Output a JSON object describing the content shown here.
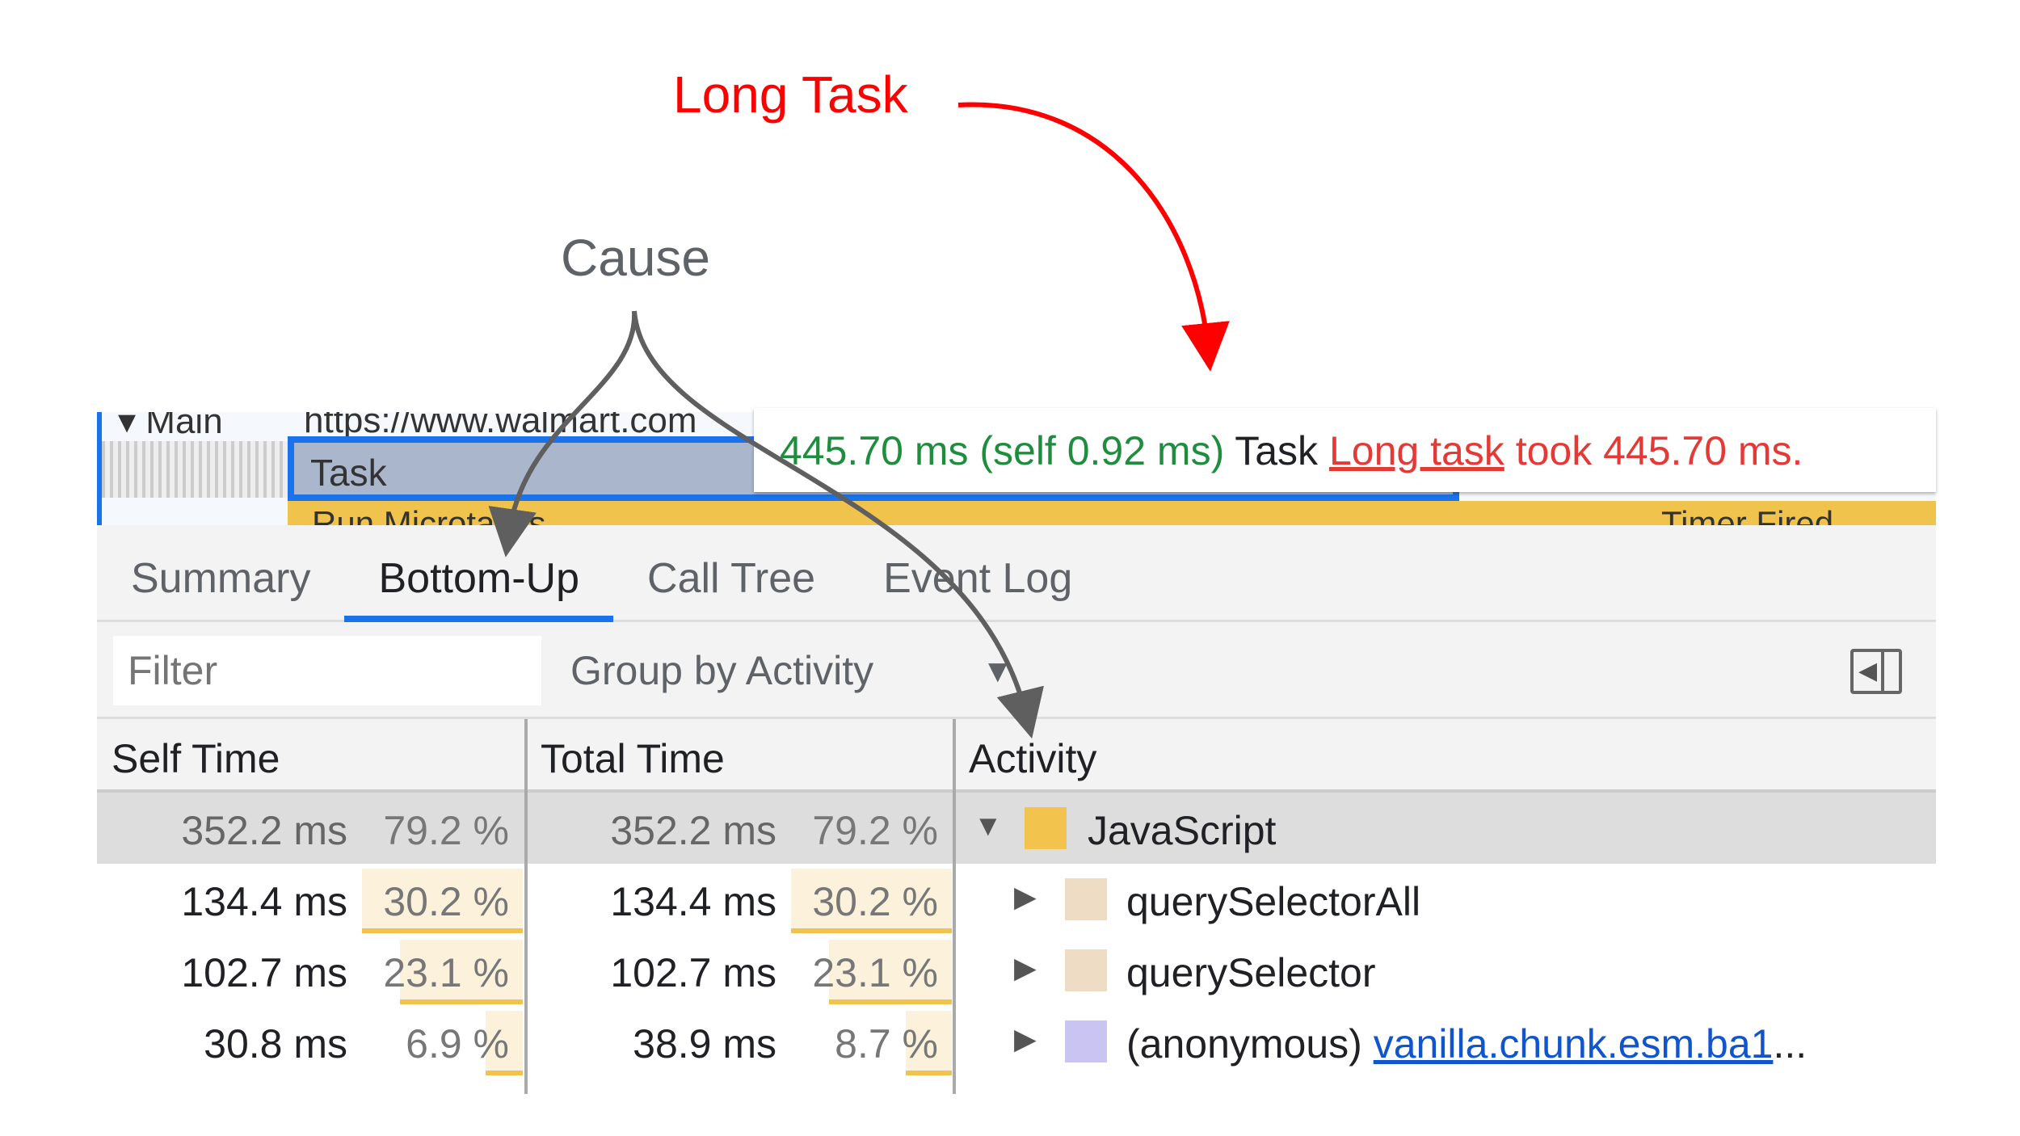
{
  "annotations": {
    "long_task": "Long Task",
    "cause": "Cause",
    "long_task_color": "#ff0000",
    "cause_color": "#5f6368"
  },
  "timeline": {
    "main_label": "▾ Main",
    "url": "https://www.walmart.com",
    "task_label": "Task",
    "microtasks": "Run Microtasks",
    "timer": "Timer Fired"
  },
  "tooltip": {
    "duration": "445.70 ms (self 0.92 ms)",
    "name": "Task",
    "link": "Long task",
    "message": "took 445.70 ms."
  },
  "tabs": [
    "Summary",
    "Bottom-Up",
    "Call Tree",
    "Event Log"
  ],
  "active_tab": "Bottom-Up",
  "toolbar": {
    "filter_placeholder": "Filter",
    "group_by": "Group by Activity"
  },
  "table": {
    "headers": [
      "Self Time",
      "Total Time",
      "Activity"
    ],
    "rows": [
      {
        "self": "352.2 ms",
        "self_pct": "79.2 %",
        "total": "352.2 ms",
        "total_pct": "79.2 %",
        "activity": "JavaScript",
        "color": "#f2c44e",
        "expanded": true,
        "selected": true
      },
      {
        "self": "134.4 ms",
        "self_pct": "30.2 %",
        "total": "134.4 ms",
        "total_pct": "30.2 %",
        "activity": "querySelectorAll",
        "color": "#efdcc4"
      },
      {
        "self": "102.7 ms",
        "self_pct": "23.1 %",
        "total": "102.7 ms",
        "total_pct": "23.1 %",
        "activity": "querySelector",
        "color": "#efdcc4"
      },
      {
        "self": "30.8 ms",
        "self_pct": "6.9 %",
        "total": "38.9 ms",
        "total_pct": "8.7 %",
        "activity": "(anonymous)",
        "link": "vanilla.chunk.esm.ba1",
        "ellipsis": "...",
        "color": "#c9c4f2"
      }
    ]
  }
}
